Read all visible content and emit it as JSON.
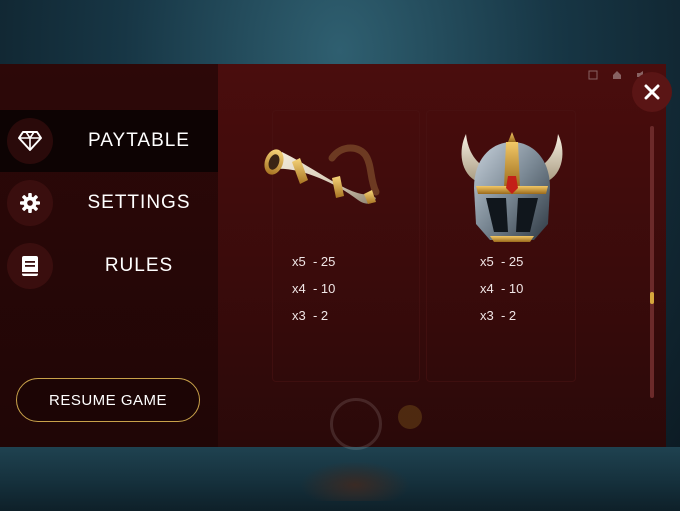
{
  "menu": {
    "items": [
      {
        "label": "PAYTABLE",
        "icon": "diamond-icon",
        "active": true
      },
      {
        "label": "SETTINGS",
        "icon": "gear-icon",
        "active": false
      },
      {
        "label": "RULES",
        "icon": "book-icon",
        "active": false
      }
    ],
    "resume_label": "RESUME GAME"
  },
  "paytable": {
    "symbols": [
      {
        "icon": "horn-icon",
        "payouts": [
          {
            "count": "x5",
            "value": "- 25"
          },
          {
            "count": "x4",
            "value": "- 10"
          },
          {
            "count": "x3",
            "value": "- 2"
          }
        ]
      },
      {
        "icon": "viking-helmet-icon",
        "payouts": [
          {
            "count": "x5",
            "value": "- 25"
          },
          {
            "count": "x4",
            "value": "- 10"
          },
          {
            "count": "x3",
            "value": "- 2"
          }
        ]
      }
    ]
  },
  "controls": {
    "close_icon": "close-icon"
  },
  "colors": {
    "accent": "#c9a24a",
    "panel": "#3a0b0b",
    "sidebar": "#200606"
  }
}
